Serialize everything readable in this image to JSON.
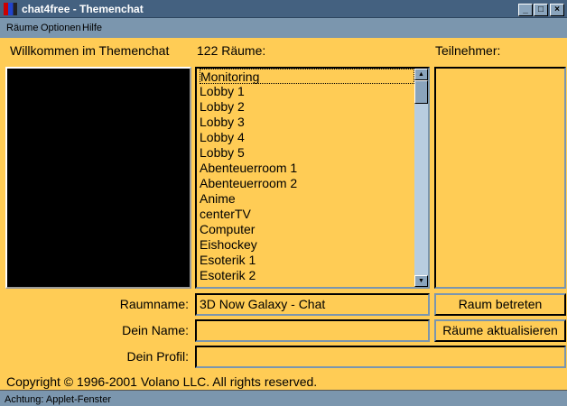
{
  "window": {
    "title": "chat4free - Themenchat",
    "minimize": "_",
    "maximize": "□",
    "close": "×"
  },
  "menu": [
    "Räume",
    "Optionen",
    "Hilfe"
  ],
  "labels": {
    "welcome": "Willkommen im Themenchat",
    "rooms_count": "122 Räume:",
    "participants": "Teilnehmer:",
    "roomname": "Raumname:",
    "yourname": "Dein Name:",
    "profile": "Dein Profil:"
  },
  "rooms": [
    "Monitoring",
    "Lobby 1",
    "Lobby 2",
    "Lobby 3",
    "Lobby 4",
    "Lobby 5",
    "Abenteuerroom 1",
    "Abenteuerroom 2",
    "Anime",
    "centerTV",
    "Computer",
    "Eishockey",
    "Esoterik 1",
    "Esoterik 2"
  ],
  "selected_room": "Monitoring",
  "fields": {
    "roomname": "3D Now Galaxy - Chat",
    "yourname": "",
    "profile": ""
  },
  "buttons": {
    "enter": "Raum betreten",
    "refresh": "Räume aktualisieren"
  },
  "copyright": "Copyright © 1996-2001 Volano LLC. All rights reserved.",
  "status": "Achtung: Applet-Fenster",
  "colors": {
    "panel": "#ffcc55",
    "titlebar": "#446180",
    "chrome": "#7b96ae"
  }
}
